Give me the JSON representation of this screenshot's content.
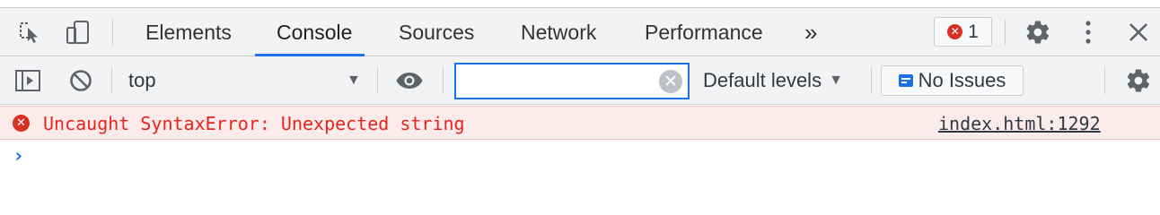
{
  "tabs": [
    {
      "label": "Elements"
    },
    {
      "label": "Console"
    },
    {
      "label": "Sources"
    },
    {
      "label": "Network"
    },
    {
      "label": "Performance"
    }
  ],
  "active_tab": "Console",
  "overflow_label": "»",
  "error_badge": {
    "count": "1"
  },
  "console_toolbar": {
    "context": "top",
    "filter_value": "",
    "levels": "Default levels",
    "issues": "No Issues"
  },
  "messages": [
    {
      "text": "Uncaught SyntaxError: Unexpected string",
      "source": "index.html:1292",
      "level": "error"
    }
  ],
  "colors": {
    "accent": "#1a73e8",
    "error": "#d93025",
    "error_bg": "#fcebeb"
  }
}
